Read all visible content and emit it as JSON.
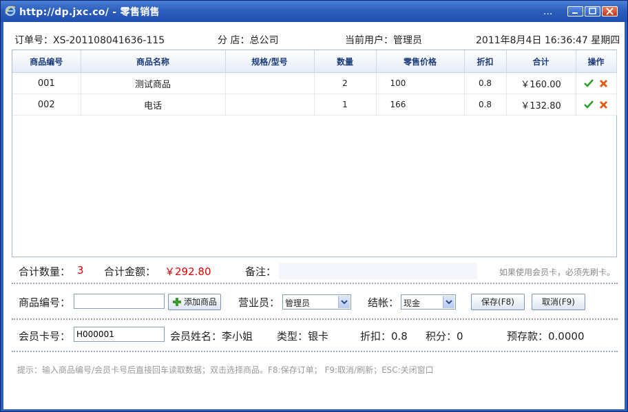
{
  "window": {
    "title": "http://dp.jxc.co/ - 零售销售",
    "dots": "..."
  },
  "info": {
    "order": "订单号：XS-201108041636-115",
    "store": "分 店：总公司",
    "user": "当前用户：管理员",
    "datetime": "2011年8月4日 16:36:47  星期四"
  },
  "table": {
    "headers": [
      "商品编号",
      "商品名称",
      "规格/型号",
      "数量",
      "零售价格",
      "折扣",
      "合计",
      "操作"
    ],
    "rows": [
      {
        "code": "001",
        "name": "测试商品",
        "spec": "",
        "qty": "2",
        "price": "100",
        "discount": "0.8",
        "total": "￥160.00"
      },
      {
        "code": "002",
        "name": "电话",
        "spec": "",
        "qty": "1",
        "price": "166",
        "discount": "0.8",
        "total": "￥132.80"
      }
    ]
  },
  "summary": {
    "qty_label": "合计数量：",
    "qty_value": "3",
    "amount_label": "合计金额：",
    "amount_value": "￥292.80",
    "note_label": "备注：",
    "hint": "如果使用会员卡，必须先刷卡。"
  },
  "entry": {
    "code_label": "商品编号：",
    "code_value": "",
    "add_button": "添加商品",
    "clerk_label": "营业员：",
    "clerk_value": "管理员",
    "checkout_label": "结帐：",
    "checkout_value": "现金",
    "save_button": "保存(F8)",
    "cancel_button": "取消(F9)"
  },
  "member": {
    "card_label": "会员卡号：",
    "card_value": "H000001",
    "name": "会员姓名：李小姐",
    "type": "类型：银卡",
    "discount": "折扣：0.8",
    "points": "积分：0",
    "deposit": "预存款：0.0000"
  },
  "tip": "提示：输入商品编号/会员卡号后直接回车读取数据；双击选择商品。F8:保存订单； F9:取消/刷新；ESC:关闭窗口",
  "colors": {
    "titlebar": "#2e5fbe",
    "accent_red": "#e00000",
    "check_green": "#2aa02a",
    "delete_orange": "#e05a10"
  }
}
